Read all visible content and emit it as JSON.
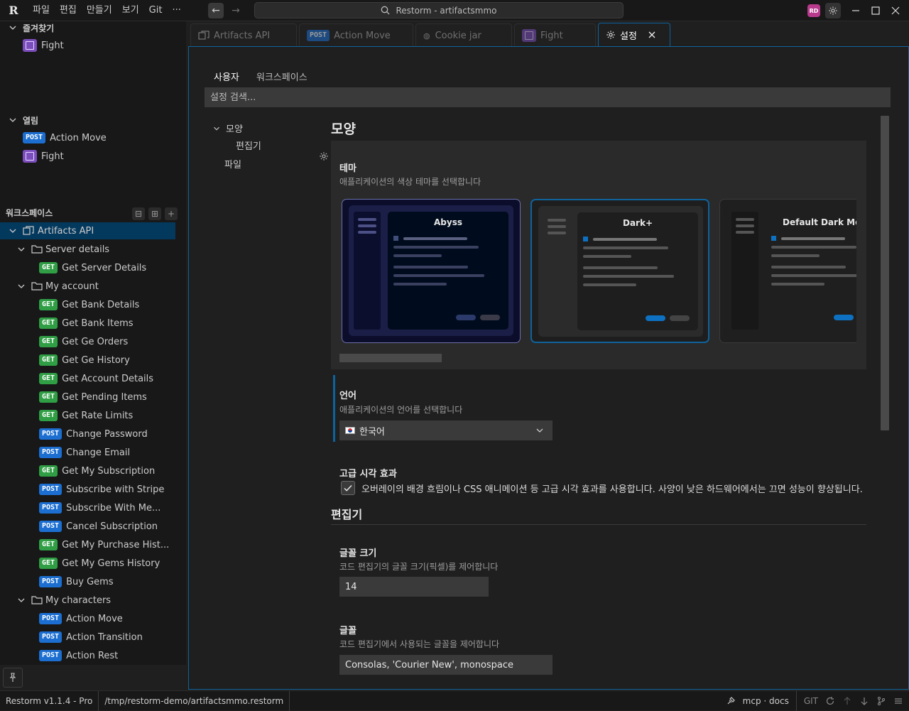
{
  "titlebar": {
    "menus": [
      "파일",
      "편집",
      "만들기",
      "보기",
      "Git",
      "···"
    ],
    "command_center": "Restorm - artifactsmmo",
    "avatar": "RD"
  },
  "sidebar": {
    "favorites": {
      "title": "즐겨찾기",
      "items": [
        {
          "label": "Fight",
          "kind": "fight"
        }
      ]
    },
    "open": {
      "title": "열림",
      "items": [
        {
          "label": "Action Move",
          "method": "POST"
        },
        {
          "label": "Fight",
          "kind": "fight"
        }
      ]
    },
    "workspace": {
      "title": "워크스페이스",
      "root": "Artifacts API",
      "groups": [
        {
          "name": "Server details",
          "items": [
            {
              "method": "GET",
              "label": "Get Server Details"
            }
          ]
        },
        {
          "name": "My account",
          "items": [
            {
              "method": "GET",
              "label": "Get Bank Details"
            },
            {
              "method": "GET",
              "label": "Get Bank Items"
            },
            {
              "method": "GET",
              "label": "Get Ge Orders"
            },
            {
              "method": "GET",
              "label": "Get Ge History"
            },
            {
              "method": "GET",
              "label": "Get Account Details"
            },
            {
              "method": "GET",
              "label": "Get Pending Items"
            },
            {
              "method": "GET",
              "label": "Get Rate Limits"
            },
            {
              "method": "POST",
              "label": "Change Password"
            },
            {
              "method": "POST",
              "label": "Change Email"
            },
            {
              "method": "GET",
              "label": "Get My Subscription"
            },
            {
              "method": "POST",
              "label": "Subscribe with Stripe"
            },
            {
              "method": "POST",
              "label": "Subscribe With Me..."
            },
            {
              "method": "POST",
              "label": "Cancel Subscription"
            },
            {
              "method": "GET",
              "label": "Get My Purchase Hist..."
            },
            {
              "method": "GET",
              "label": "Get My Gems History"
            },
            {
              "method": "POST",
              "label": "Buy Gems"
            }
          ]
        },
        {
          "name": "My characters",
          "items": [
            {
              "method": "POST",
              "label": "Action Move"
            },
            {
              "method": "POST",
              "label": "Action Transition"
            },
            {
              "method": "POST",
              "label": "Action Rest"
            }
          ]
        }
      ]
    }
  },
  "tabs": [
    {
      "label": "Artifacts API",
      "kind": "api"
    },
    {
      "label": "Action Move",
      "method": "POST"
    },
    {
      "label": "Cookie jar",
      "kind": "cookie"
    },
    {
      "label": "Fight",
      "kind": "fight"
    },
    {
      "label": "설정",
      "kind": "settings",
      "active": true
    }
  ],
  "settings": {
    "scopes": [
      "사용자",
      "워크스페이스"
    ],
    "search_placeholder": "설정 검색...",
    "toc": {
      "appearance": "모양",
      "editor": "편집기",
      "file": "파일"
    },
    "appearance": {
      "heading": "모양",
      "theme": {
        "title": "테마",
        "desc": "애플리케이션의 색상 테마를 선택합니다",
        "options": [
          "Abyss",
          "Dark+",
          "Default Dark Mode"
        ],
        "selected": "Dark+"
      },
      "language": {
        "title": "언어",
        "desc": "애플리케이션의 언어를 선택합니다",
        "value": "한국어"
      },
      "effects": {
        "title": "고급 시각 효과",
        "label": "오버레이의 배경 흐림이나 CSS 애니메이션 등 고급 시각 효과를 사용합니다. 사양이 낮은 하드웨어에서는 끄면 성능이 향상됩니다.",
        "checked": true
      }
    },
    "editor": {
      "heading": "편집기",
      "font_size": {
        "title": "글꼴 크기",
        "desc": "코드 편집기의 글꼴 크기(픽셀)를 제어합니다",
        "value": "14"
      },
      "font": {
        "title": "글꼴",
        "desc": "코드 편집기에서 사용되는 글꼴을 제어합니다",
        "value": "Consolas, 'Courier New', monospace"
      }
    }
  },
  "statusbar": {
    "version": "Restorm v1.1.4 - Pro",
    "path": "/tmp/restorm-demo/artifactsmmo.restorm",
    "mcp": "mcp · docs",
    "git": "GIT"
  },
  "colors": {
    "accent": "#0e639c",
    "get": "#2f9e44",
    "post": "#1c6fd1",
    "fight": "#7c4dbd"
  }
}
